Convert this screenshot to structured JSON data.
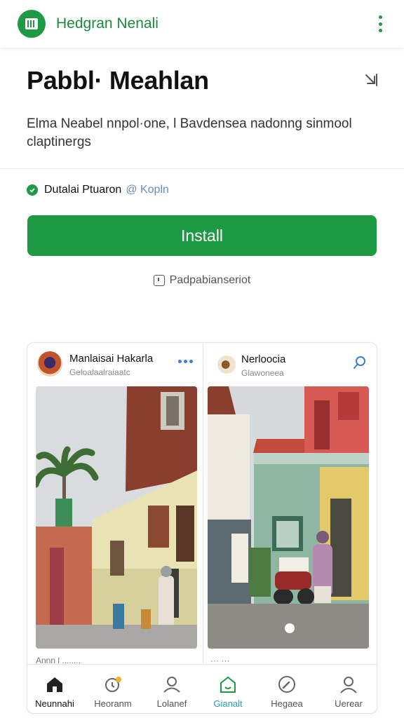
{
  "app_bar": {
    "title": "Hedgran Nenali",
    "menu_icon": "more-vertical-icon"
  },
  "header": {
    "title": "Pabbl· Meahlan",
    "share_icon": "arrow-out-icon",
    "description": "Elma Neabel nnpol·one, l Bavdensea nadonng sinmool claptinergs"
  },
  "verified": {
    "name": "Dutalai Ptuaron",
    "link": "@ Kopln"
  },
  "install_button": {
    "label": "Install"
  },
  "secondary_link": {
    "label": "Padpabianseriot"
  },
  "feed": {
    "left_post": {
      "name": "Manlaisai Hakarla",
      "subtitle": "Geloalaalraiaatc",
      "caption": "Annn l ........"
    },
    "right_post": {
      "name": "Nerloocia",
      "subtitle": "Glawoneea",
      "caption": "··· ···"
    }
  },
  "bottom_nav": {
    "items": [
      {
        "label": "Neunnahi",
        "icon": "home-icon"
      },
      {
        "label": "Heoranm",
        "icon": "notification-icon"
      },
      {
        "label": "Lolanef",
        "icon": "profile-icon"
      },
      {
        "label": "Gianalt",
        "icon": "shop-icon"
      },
      {
        "label": "Hegaea",
        "icon": "compass-icon"
      },
      {
        "label": "Uerear",
        "icon": "user-icon"
      }
    ]
  },
  "colors": {
    "brand_green": "#1e9a45",
    "active_nav": "#2a9ab6",
    "link_blue": "#6a8fb8"
  }
}
